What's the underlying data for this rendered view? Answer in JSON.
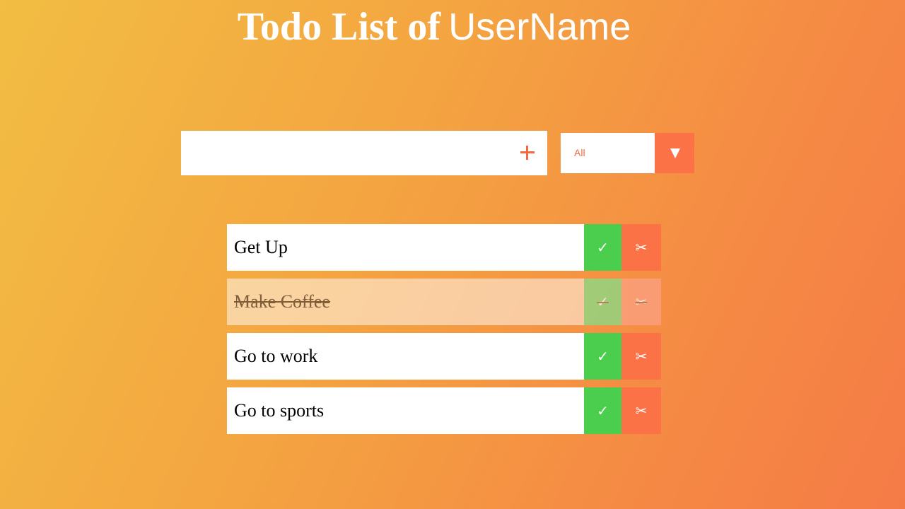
{
  "header": {
    "title_part1": "Todo List of",
    "title_part2": "UserName"
  },
  "add_todo": {
    "value": "",
    "button_icon": "plus-icon"
  },
  "filter": {
    "selected": "All",
    "arrow_icon": "triangle-down-icon"
  },
  "todos": [
    {
      "text": "Get Up",
      "completed": false,
      "complete_glyph": "✓",
      "delete_glyph": "✂"
    },
    {
      "text": "Make Coffee",
      "completed": true,
      "complete_glyph": "✓",
      "delete_glyph": "✂"
    },
    {
      "text": "Go to work",
      "completed": false,
      "complete_glyph": "✓",
      "delete_glyph": "✂"
    },
    {
      "text": "Go to sports",
      "completed": false,
      "complete_glyph": "✓",
      "delete_glyph": "✂"
    }
  ],
  "colors": {
    "background_start": "#f2bd42",
    "background_end": "#f57b46",
    "accent": "#fb7246",
    "complete_green": "#4bcd4e",
    "plus_orange": "#f4693e"
  }
}
